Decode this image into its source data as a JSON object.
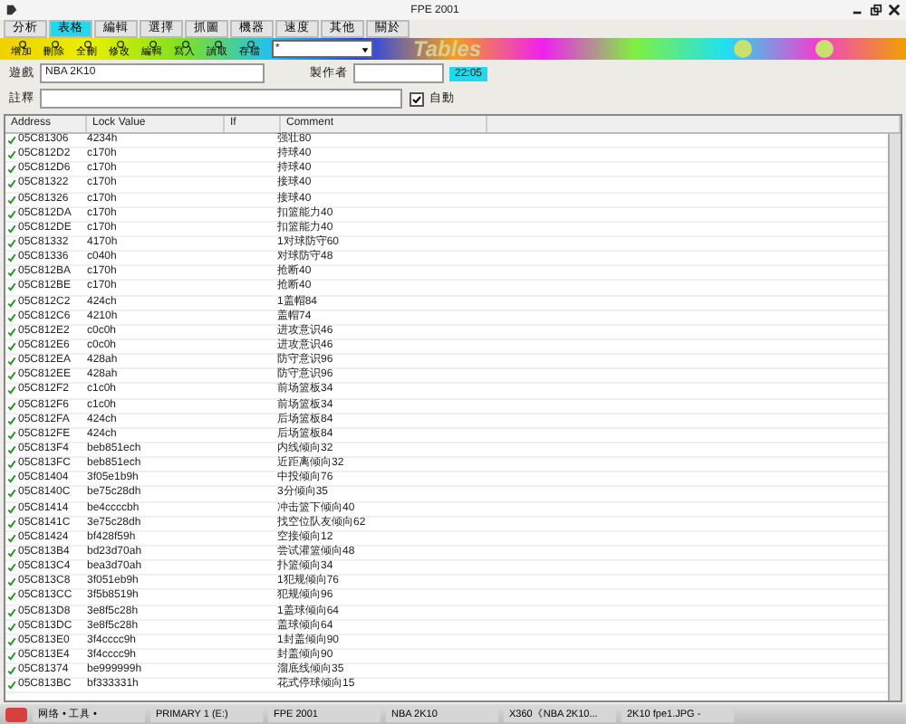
{
  "window": {
    "title": "FPE 2001"
  },
  "tabs": [
    {
      "label": "分析",
      "selected": false
    },
    {
      "label": "表格",
      "selected": true
    },
    {
      "label": "編輯",
      "selected": false
    },
    {
      "label": "選擇",
      "selected": false
    },
    {
      "label": "抓圖",
      "selected": false
    },
    {
      "label": "機器",
      "selected": false
    },
    {
      "label": "速度",
      "selected": false
    },
    {
      "label": "其他",
      "selected": false
    },
    {
      "label": "關於",
      "selected": false
    }
  ],
  "toolbar": {
    "buttons": [
      "增加",
      "刪除",
      "全刪",
      "修改",
      "編輯",
      "寫入",
      "讀取",
      "存檔"
    ],
    "dropdown": "*",
    "banner_text": "Tables"
  },
  "form": {
    "game_label": "遊戲",
    "game": "NBA 2K10",
    "author_label": "製作者",
    "time": "22:05",
    "note_label": "註釋",
    "auto": {
      "label": "自動",
      "checked": true
    }
  },
  "table": {
    "columns": [
      "Address",
      "Lock Value",
      "If",
      "Comment"
    ],
    "rows": [
      {
        "locked": true,
        "address": "05C81306",
        "value": "4234h",
        "comment": "强壮80"
      },
      {
        "locked": true,
        "address": "05C812D2",
        "value": "c170h",
        "comment": "持球40"
      },
      {
        "locked": true,
        "address": "05C812D6",
        "value": "c170h",
        "comment": "持球40"
      },
      {
        "locked": true,
        "address": "05C81322",
        "value": "c170h",
        "comment": "接球40"
      },
      {
        "locked": true,
        "address": "05C81326",
        "value": "c170h",
        "comment": "接球40"
      },
      {
        "locked": true,
        "address": "05C812DA",
        "value": "c170h",
        "comment": "扣篮能力40"
      },
      {
        "locked": true,
        "address": "05C812DE",
        "value": "c170h",
        "comment": "扣篮能力40"
      },
      {
        "locked": true,
        "address": "05C81332",
        "value": "4170h",
        "comment": "1对球防守60"
      },
      {
        "locked": true,
        "address": "05C81336",
        "value": "c040h",
        "comment": "对球防守48"
      },
      {
        "locked": true,
        "address": "05C812BA",
        "value": "c170h",
        "comment": "抢断40"
      },
      {
        "locked": true,
        "address": "05C812BE",
        "value": "c170h",
        "comment": "抢断40"
      },
      {
        "locked": true,
        "address": "05C812C2",
        "value": "424ch",
        "comment": "1盖帽84"
      },
      {
        "locked": true,
        "address": "05C812C6",
        "value": "4210h",
        "comment": "盖帽74"
      },
      {
        "locked": true,
        "address": "05C812E2",
        "value": "c0c0h",
        "comment": "进攻意识46"
      },
      {
        "locked": true,
        "address": "05C812E6",
        "value": "c0c0h",
        "comment": "进攻意识46"
      },
      {
        "locked": true,
        "address": "05C812EA",
        "value": "428ah",
        "comment": "防守意识96"
      },
      {
        "locked": true,
        "address": "05C812EE",
        "value": "428ah",
        "comment": "防守意识96"
      },
      {
        "locked": true,
        "address": "05C812F2",
        "value": "c1c0h",
        "comment": "前场篮板34"
      },
      {
        "locked": true,
        "address": "05C812F6",
        "value": "c1c0h",
        "comment": "前场篮板34"
      },
      {
        "locked": true,
        "address": "05C812FA",
        "value": "424ch",
        "comment": "后场篮板84"
      },
      {
        "locked": true,
        "address": "05C812FE",
        "value": "424ch",
        "comment": "后场篮板84"
      },
      {
        "locked": true,
        "address": "05C813F4",
        "value": "beb851ech",
        "comment": "内线倾向32"
      },
      {
        "locked": true,
        "address": "05C813FC",
        "value": "beb851ech",
        "comment": "近距离倾向32"
      },
      {
        "locked": true,
        "address": "05C81404",
        "value": "3f05e1b9h",
        "comment": "中投倾向76"
      },
      {
        "locked": true,
        "address": "05C8140C",
        "value": "be75c28dh",
        "comment": "3分倾向35"
      },
      {
        "locked": true,
        "address": "05C81414",
        "value": "be4ccccbh",
        "comment": "冲击篮下倾向40"
      },
      {
        "locked": true,
        "address": "05C8141C",
        "value": "3e75c28dh",
        "comment": "找空位队友倾向62"
      },
      {
        "locked": true,
        "address": "05C81424",
        "value": "bf428f59h",
        "comment": "空接倾向12"
      },
      {
        "locked": true,
        "address": "05C813B4",
        "value": "bd23d70ah",
        "comment": "尝试灌篮倾向48"
      },
      {
        "locked": true,
        "address": "05C813C4",
        "value": "bea3d70ah",
        "comment": "扑篮倾向34"
      },
      {
        "locked": true,
        "address": "05C813C8",
        "value": "3f051eb9h",
        "comment": "1犯规倾向76"
      },
      {
        "locked": true,
        "address": "05C813CC",
        "value": "3f5b8519h",
        "comment": "犯规倾向96"
      },
      {
        "locked": true,
        "address": "05C813D8",
        "value": "3e8f5c28h",
        "comment": "1盖球倾向64"
      },
      {
        "locked": true,
        "address": "05C813DC",
        "value": "3e8f5c28h",
        "comment": "盖球倾向64"
      },
      {
        "locked": true,
        "address": "05C813E0",
        "value": "3f4cccc9h",
        "comment": "1封盖倾向90"
      },
      {
        "locked": true,
        "address": "05C813E4",
        "value": "3f4cccc9h",
        "comment": "封盖倾向90"
      },
      {
        "locked": true,
        "address": "05C81374",
        "value": "be999999h",
        "comment": "溜底线倾向35"
      },
      {
        "locked": true,
        "address": "05C813BC",
        "value": "bf333331h",
        "comment": "花式停球倾向15"
      }
    ]
  },
  "taskbar": {
    "items": [
      "网络 • 工具 •",
      "PRIMARY 1 (E:)",
      "FPE 2001",
      "NBA 2K10",
      "X360《NBA 2K10...",
      "2K10 fpe1.JPG -"
    ]
  }
}
